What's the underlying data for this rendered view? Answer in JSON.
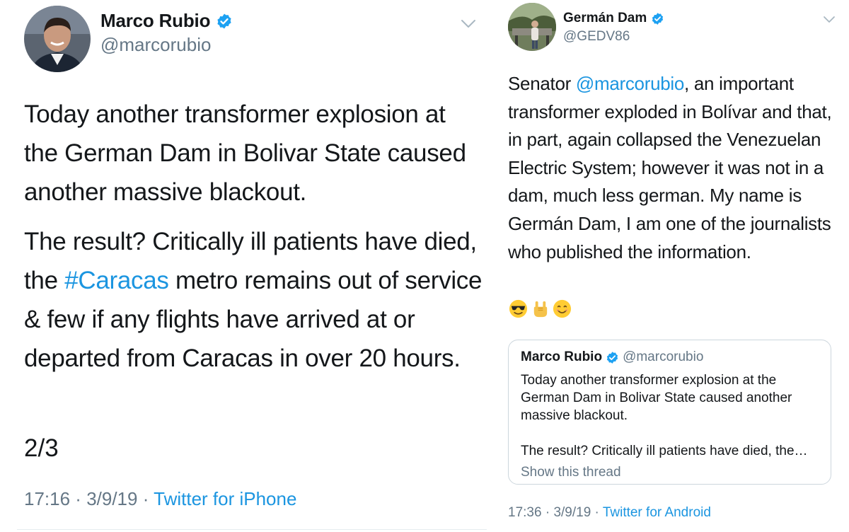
{
  "colors": {
    "link": "#1b95e0",
    "secondary_text": "#657786",
    "primary_text": "#14171a",
    "verified_badge": "#1da1f2",
    "border": "#ccd6dd"
  },
  "left_tweet": {
    "author": {
      "name": "Marco Rubio",
      "handle": "@marcorubio",
      "verified_icon": "verified-badge-icon",
      "avatar": "avatar"
    },
    "menu_icon": "chevron-down-icon",
    "text": {
      "para1": "Today another transformer explosion at the German Dam in Bolivar State caused another massive blackout.",
      "para2_part1": "The result? Critically ill patients have died, the ",
      "para2_hashtag": "#Caracas",
      "para2_part2": " metro remains out of service & few if any flights have arrived at or departed from Caracas in over 20 hours."
    },
    "page_marker": "2/3",
    "meta": {
      "time": "17:16",
      "sep1": " · ",
      "date": "3/9/19",
      "sep2": " · ",
      "source": "Twitter for iPhone"
    }
  },
  "right_tweet": {
    "author": {
      "name": "Germán Dam",
      "handle": "@GEDV86",
      "verified_icon": "verified-badge-icon",
      "avatar": "avatar"
    },
    "menu_icon": "chevron-down-icon",
    "text": {
      "part1": "Senator ",
      "mention": "@marcorubio",
      "part2": ", an important transformer exploded in Bolívar and that, in part, again collapsed the Venezuelan Electric System; however it was not in a dam, much less german. My name is Germán Dam, I am one of the journalists who published the information."
    },
    "emojis": [
      "sunglasses-face-emoji",
      "rock-on-hand-emoji",
      "smiling-face-emoji"
    ],
    "quoted_tweet": {
      "name": "Marco Rubio",
      "handle": "@marcorubio",
      "para1": "Today another transformer explosion at the German Dam in Bolivar State caused another massive blackout.",
      "para2": "The result? Critically ill patients have died, the…",
      "show_thread": "Show this thread"
    },
    "meta": {
      "time": "17:36",
      "sep1": " · ",
      "date": "3/9/19",
      "sep2": " · ",
      "source": "Twitter for Android"
    }
  }
}
